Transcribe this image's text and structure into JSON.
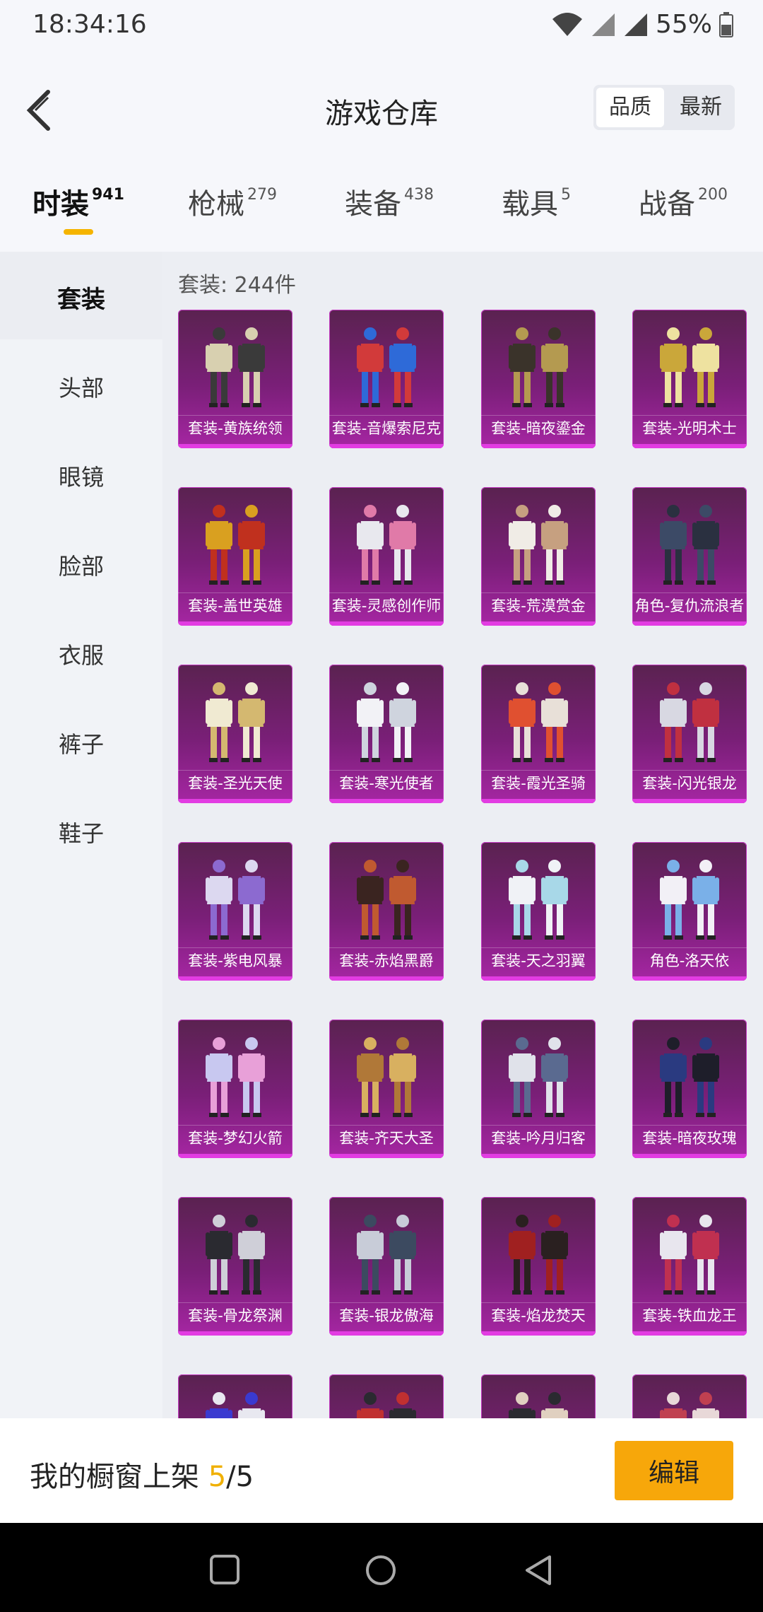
{
  "status_bar": {
    "time": "18:34:16",
    "battery": "55%"
  },
  "header": {
    "title": "游戏仓库",
    "sort_options": [
      "品质",
      "最新"
    ],
    "sort_selected": "品质"
  },
  "tabs": [
    {
      "label": "时装",
      "count": "941",
      "active": true
    },
    {
      "label": "枪械",
      "count": "279"
    },
    {
      "label": "装备",
      "count": "438"
    },
    {
      "label": "载具",
      "count": "5"
    },
    {
      "label": "战备",
      "count": "200"
    }
  ],
  "sidebar": {
    "items": [
      "套装",
      "头部",
      "眼镜",
      "脸部",
      "衣服",
      "裤子",
      "鞋子"
    ],
    "selected": "套装"
  },
  "main": {
    "count_label": "套装: 244件",
    "items": [
      {
        "label": "套装-黄族统领",
        "colors": [
          "#d8d0b0",
          "#3a3a3a"
        ]
      },
      {
        "label": "套装-音爆索尼克",
        "colors": [
          "#d23a3a",
          "#2e6ad8"
        ]
      },
      {
        "label": "套装-暗夜鎏金",
        "colors": [
          "#3a332a",
          "#b49a50"
        ]
      },
      {
        "label": "套装-光明术士",
        "colors": [
          "#caa73a",
          "#eee2a0"
        ]
      },
      {
        "label": "套装-盖世英雄",
        "colors": [
          "#d9a020",
          "#c0301e"
        ]
      },
      {
        "label": "套装-灵感创作师",
        "colors": [
          "#e8e8ee",
          "#e07aa8"
        ]
      },
      {
        "label": "套装-荒漠赏金",
        "colors": [
          "#f0ece6",
          "#c6a080"
        ]
      },
      {
        "label": "角色-复仇流浪者",
        "colors": [
          "#3c4a66",
          "#2a3040"
        ]
      },
      {
        "label": "套装-圣光天使",
        "colors": [
          "#f0ead2",
          "#d4b870"
        ]
      },
      {
        "label": "套装-寒光使者",
        "colors": [
          "#f2f2f6",
          "#cfd4de"
        ]
      },
      {
        "label": "套装-霞光圣骑",
        "colors": [
          "#e05030",
          "#e8e0d8"
        ]
      },
      {
        "label": "套装-闪光银龙",
        "colors": [
          "#d8d8e2",
          "#c03040"
        ]
      },
      {
        "label": "套装-紫电风暴",
        "colors": [
          "#dcd8f0",
          "#8c6ad0"
        ]
      },
      {
        "label": "套装-赤焰黑爵",
        "colors": [
          "#3a2420",
          "#c05a30"
        ]
      },
      {
        "label": "套装-天之羽翼",
        "colors": [
          "#f0f2f6",
          "#a8d8e8"
        ]
      },
      {
        "label": "角色-洛天依",
        "colors": [
          "#f2f0f6",
          "#7ab0e8"
        ]
      },
      {
        "label": "套装-梦幻火箭",
        "colors": [
          "#c8c8f0",
          "#e8a0d8"
        ]
      },
      {
        "label": "套装-齐天大圣",
        "colors": [
          "#b07838",
          "#d8b060"
        ]
      },
      {
        "label": "套装-吟月归客",
        "colors": [
          "#e0e2ea",
          "#5a6a90"
        ]
      },
      {
        "label": "套装-暗夜玫瑰",
        "colors": [
          "#2a3a80",
          "#1e1e2a"
        ]
      },
      {
        "label": "套装-骨龙祭渊",
        "colors": [
          "#2a2a30",
          "#cfcfd8"
        ]
      },
      {
        "label": "套装-银龙傲海",
        "colors": [
          "#c8ccd8",
          "#3c4a60"
        ]
      },
      {
        "label": "套装-焰龙焚天",
        "colors": [
          "#a02020",
          "#2a2020"
        ]
      },
      {
        "label": "套装-铁血龙王",
        "colors": [
          "#e8e6ee",
          "#c03050"
        ]
      },
      {
        "label": "",
        "colors": [
          "#3a3ad0",
          "#e8e8f0"
        ]
      },
      {
        "label": "",
        "colors": [
          "#c03030",
          "#2a2a30"
        ]
      },
      {
        "label": "",
        "colors": [
          "#2a2a30",
          "#e0d0c0"
        ]
      },
      {
        "label": "",
        "colors": [
          "#c04050",
          "#e8d8d8"
        ]
      }
    ]
  },
  "footer": {
    "text_prefix": "我的橱窗上架 ",
    "count_current": "5",
    "count_sep": "/",
    "count_total": "5",
    "edit_button": "编辑"
  },
  "colors": {
    "accent": "#f5b400",
    "card_purple": "#a626a3",
    "edit_button": "#f7a70a"
  }
}
